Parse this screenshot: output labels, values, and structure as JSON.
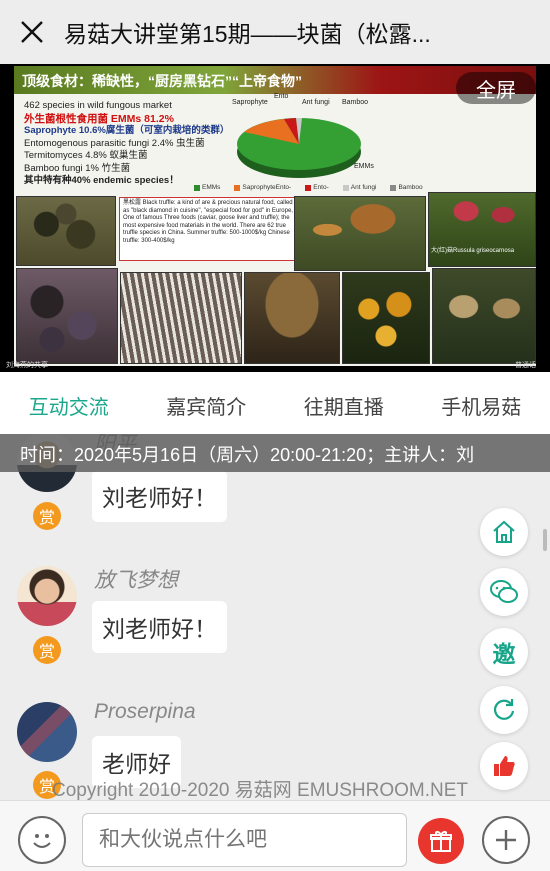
{
  "window": {
    "title": "易菇大讲堂第15期——块菌（松露..."
  },
  "video": {
    "fullscreen_label": "全屏",
    "slide": {
      "heading": "顶级食材：稀缺性，“厨房黑钻石”“上帝食物”",
      "bullets": [
        {
          "text": "462 species in wild fungous market",
          "style": "plain"
        },
        {
          "text": "外生菌根性食用菌 EMMs  81.2%",
          "style": "red"
        },
        {
          "text": "Saprophyte 10.6%腐生菌（可室内栽培的类群）",
          "style": "blue"
        },
        {
          "text": "Entomogenous parasitic fungi  2.4% 虫生菌",
          "style": "plain"
        },
        {
          "text": "Termitomyces 4.8% 蚁巢生菌",
          "style": "plain"
        },
        {
          "text": "Bamboo fungi 1% 竹生菌",
          "style": "plain"
        },
        {
          "text": "其中特有种40% endemic species！",
          "style": "bold"
        }
      ],
      "pie_labels": [
        "Saprophyte",
        "Ento",
        "Ant fungi",
        "Bamboo",
        "EMMs"
      ],
      "legend": [
        "EMMs",
        "SaprophyteEnto-",
        "Ento-",
        "Ant fungi",
        "Bamboo"
      ],
      "note": "黑松露 Black truffle: a kind of are & precious natural food, called as \"black diamond in cuisine\", \"especial food for god\" in Europe, One of famous Three foods (caviar, goose liver and truffle); the most expensive food materials in the world. There are 62 true truffle species in China. Summer truffle: 500-1000$/kg Chinese truffle: 300-400$/kg",
      "caption_russula": "大(红)菇Russula griseocarnosa",
      "footer_left": "刘海燕的共享",
      "footer_right": "普通话"
    },
    "colors": {
      "pie_emm": "#2e8b2e",
      "pie_sapro": "#e87020",
      "pie_red": "#c81818"
    }
  },
  "tabs": [
    {
      "label": "互动交流",
      "active": true
    },
    {
      "label": "嘉宾简介",
      "active": false
    },
    {
      "label": "往期直播",
      "active": false
    },
    {
      "label": "手机易菇",
      "active": false
    }
  ],
  "notice": "时间：2020年5月16日（周六）20:00-21:20；主讲人：刘",
  "messages": [
    {
      "user": "阳平",
      "text": "刘老师好！",
      "reward": "赏"
    },
    {
      "user": "放飞梦想",
      "text": "刘老师好！",
      "reward": "赏"
    },
    {
      "user": "Proserpina",
      "text": "老师好",
      "reward": "赏"
    }
  ],
  "watermark": "Copyright 2010-2020 易菇网 EMUSHROOM.NET",
  "fabs": {
    "invite_label": "邀"
  },
  "input": {
    "placeholder": "和大伙说点什么吧"
  },
  "accent": "#1aa88c"
}
